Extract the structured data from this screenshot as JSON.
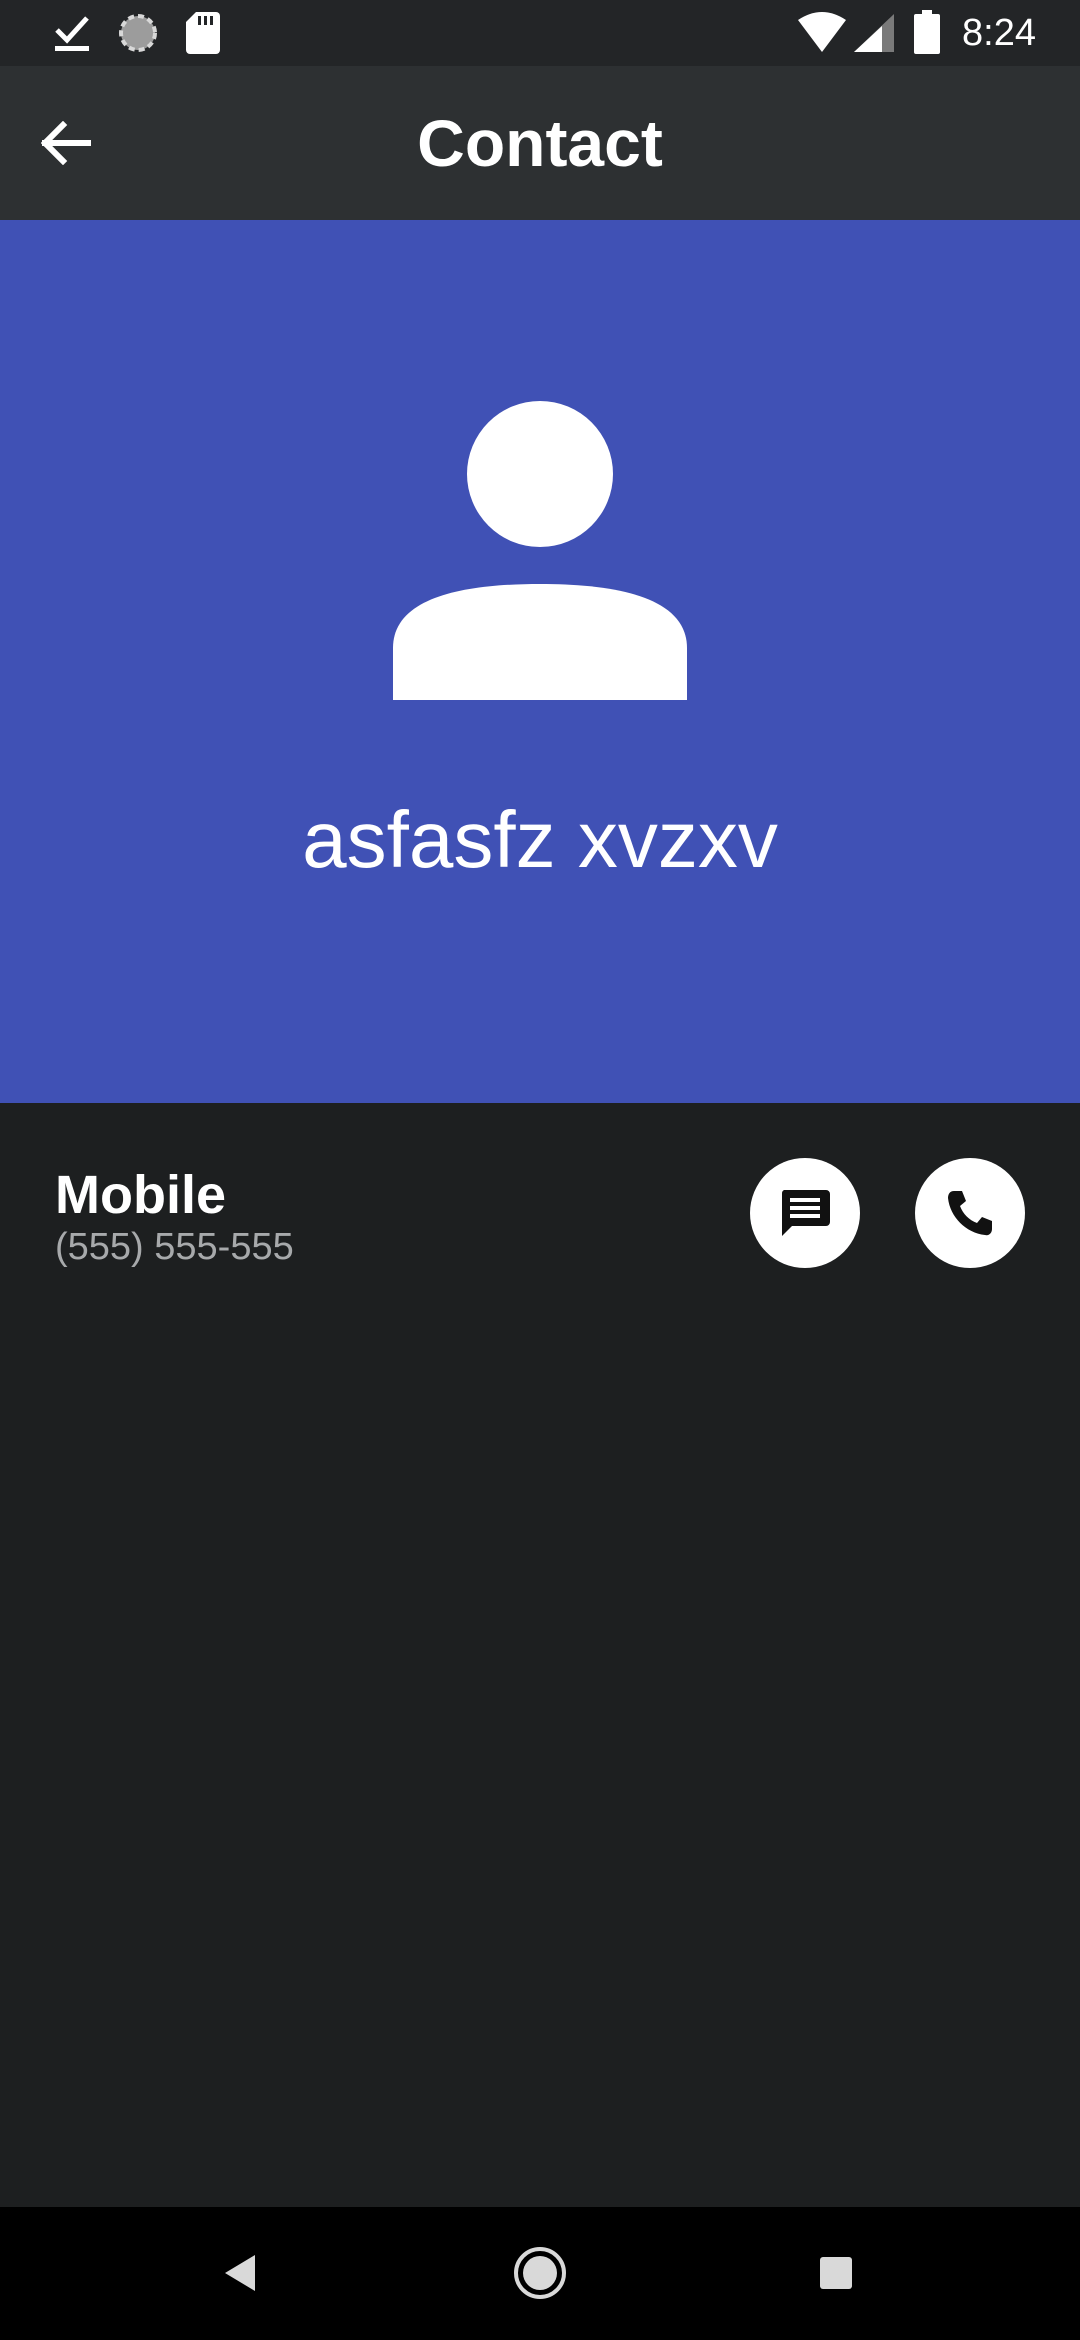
{
  "status_bar": {
    "time": "8:24",
    "left_icons": [
      "download-done-icon",
      "loading-spinner-icon",
      "sd-card-icon"
    ],
    "right_icons": [
      "wifi-icon",
      "cell-signal-icon",
      "battery-icon"
    ]
  },
  "app_bar": {
    "title": "Contact",
    "back_icon": "arrow-left-icon"
  },
  "contact": {
    "name": "asfasfz xvzxv",
    "avatar_icon": "person-icon",
    "header_color": "#4051b5"
  },
  "phone": {
    "type": "Mobile",
    "number": "(555) 555-555",
    "message_icon": "message-icon",
    "call_icon": "phone-icon"
  },
  "nav_bar": {
    "icons": [
      "nav-back-icon",
      "nav-home-icon",
      "nav-recents-icon"
    ]
  }
}
